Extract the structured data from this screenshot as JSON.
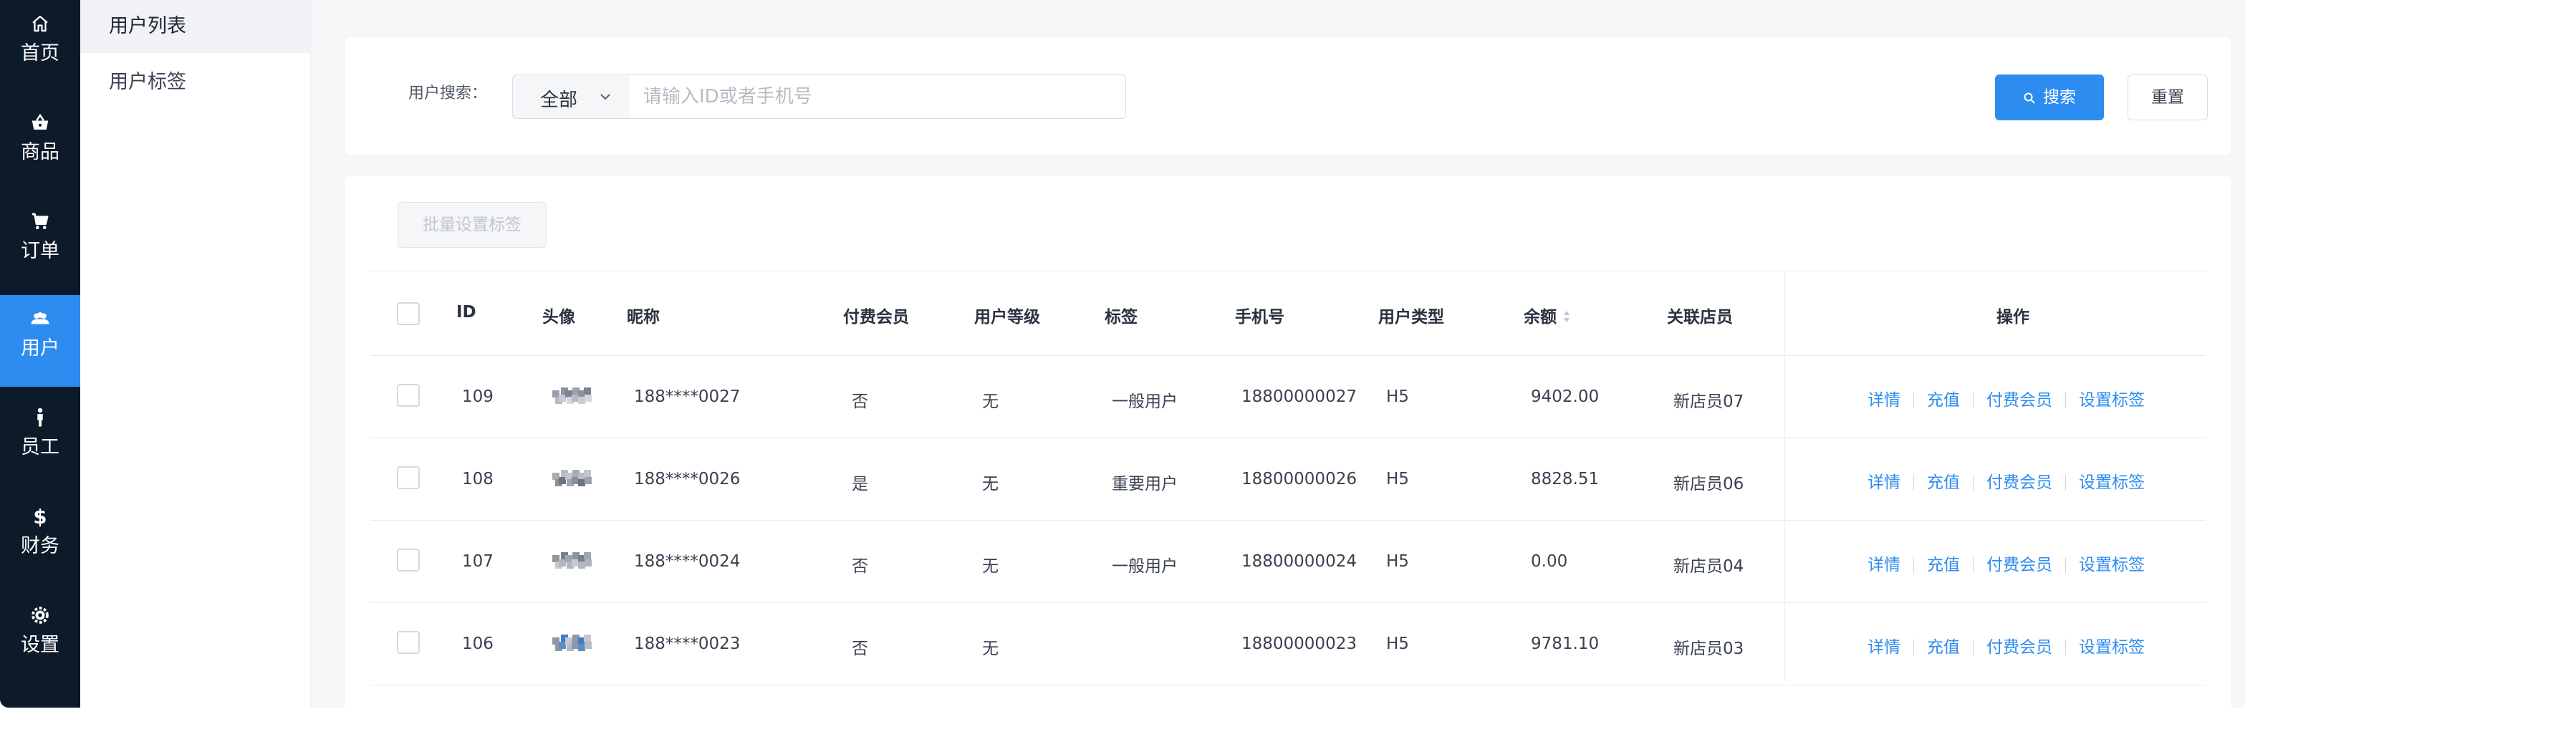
{
  "nav": {
    "items": [
      {
        "label": "首页",
        "icon": "home-icon"
      },
      {
        "label": "商品",
        "icon": "shopping-basket-icon"
      },
      {
        "label": "订单",
        "icon": "cart-icon"
      },
      {
        "label": "用户",
        "icon": "users-icon",
        "active": true
      },
      {
        "label": "员工",
        "icon": "person-icon"
      },
      {
        "label": "财务",
        "icon": "dollar-icon"
      },
      {
        "label": "设置",
        "icon": "gear-icon"
      }
    ],
    "active_color": "#2d8cf0",
    "background": "#0c1a2a"
  },
  "subnav": {
    "items": [
      {
        "label": "用户列表",
        "active": true
      },
      {
        "label": "用户标签"
      }
    ]
  },
  "search": {
    "label": "用户搜索：",
    "type_value": "全部",
    "placeholder": "请输入ID或者手机号",
    "search_button": "搜索",
    "reset_button": "重置"
  },
  "table": {
    "batch_button": "批量设置标签",
    "columns": {
      "id": "ID",
      "avatar": "头像",
      "nickname": "昵称",
      "paid_member": "付费会员",
      "level": "用户等级",
      "tag": "标签",
      "phone": "手机号",
      "user_type": "用户类型",
      "balance": "余额",
      "staff": "关联店员",
      "actions": "操作"
    },
    "actions": [
      "详情",
      "充值",
      "付费会员",
      "设置标签"
    ],
    "rows": [
      {
        "id": "109",
        "nickname": "188****0027",
        "paid_member": "否",
        "level": "无",
        "tag": "一般用户",
        "phone": "18800000027",
        "user_type": "H5",
        "balance": "9402.00",
        "staff": "新店员07"
      },
      {
        "id": "108",
        "nickname": "188****0026",
        "paid_member": "是",
        "level": "无",
        "tag": "重要用户",
        "phone": "18800000026",
        "user_type": "H5",
        "balance": "8828.51",
        "staff": "新店员06"
      },
      {
        "id": "107",
        "nickname": "188****0024",
        "paid_member": "否",
        "level": "无",
        "tag": "一般用户",
        "phone": "18800000024",
        "user_type": "H5",
        "balance": "0.00",
        "staff": "新店员04"
      },
      {
        "id": "106",
        "nickname": "188****0023",
        "paid_member": "否",
        "level": "无",
        "tag": "",
        "phone": "18800000023",
        "user_type": "H5",
        "balance": "9781.10",
        "staff": "新店员03"
      }
    ]
  }
}
